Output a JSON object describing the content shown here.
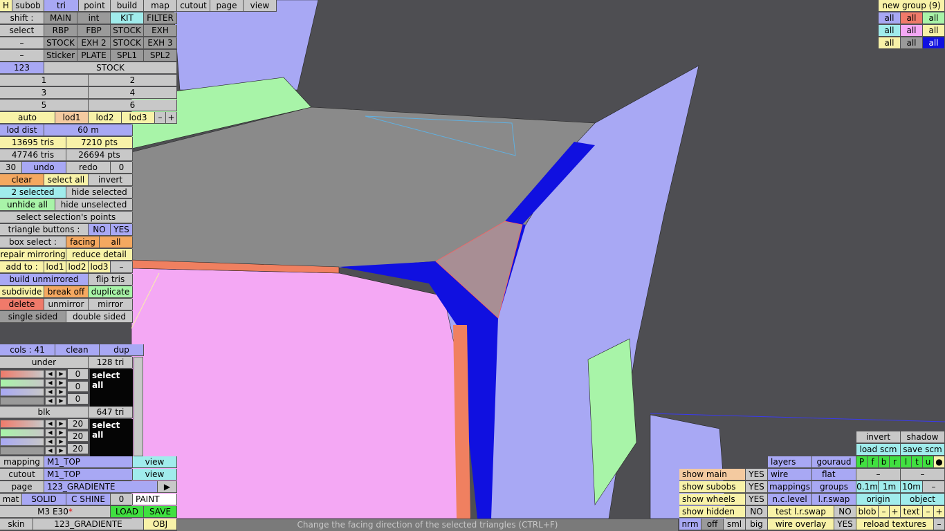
{
  "topbar": {
    "h": "H",
    "subob": "subob",
    "tri": "tri",
    "point": "point",
    "build": "build",
    "map": "map",
    "cutout": "cutout",
    "page": "page",
    "view": "view"
  },
  "shift_row": {
    "label": "shift :",
    "items": [
      "MAIN",
      "int",
      "KIT",
      "FILTER"
    ]
  },
  "select_row": {
    "label": "select",
    "items": [
      "RBP",
      "FBP",
      "STOCK",
      "EXH"
    ]
  },
  "row4": {
    "label": "–",
    "items": [
      "STOCK",
      "EXH 2",
      "STOCK",
      "EXH 3"
    ]
  },
  "row5": {
    "label": "–",
    "items": [
      "Sticker",
      "PLATE",
      "SPL1",
      "SPL2"
    ]
  },
  "group_row": {
    "num": "123",
    "name": "STOCK"
  },
  "numbers": [
    "1",
    "2",
    "3",
    "4",
    "5",
    "6"
  ],
  "lod": {
    "auto": "auto",
    "lod1": "lod1",
    "lod2": "lod2",
    "lod3": "lod3",
    "minus": "–",
    "plus": "+"
  },
  "lod_dist": {
    "label": "lod dist",
    "value": "60 m"
  },
  "stats": {
    "tris1": "13695 tris",
    "pts1": "7210 pts",
    "tris2": "47746 tris",
    "pts2": "26694 pts"
  },
  "undo_row": {
    "left": "30",
    "undo": "undo",
    "redo": "redo",
    "right": "0"
  },
  "selection": {
    "clear": "clear",
    "select_all": "select all",
    "invert": "invert",
    "count": "2 selected",
    "hide_selected": "hide selected",
    "unhide_all": "unhide all",
    "hide_unselected": "hide unselected",
    "select_points": "select selection's points"
  },
  "triangle_buttons": {
    "label": "triangle buttons :",
    "no": "NO",
    "yes": "YES"
  },
  "box_select": {
    "label": "box select :",
    "facing": "facing",
    "all": "all"
  },
  "repair": {
    "repair": "repair mirroring",
    "reduce": "reduce detail"
  },
  "add_to": {
    "label": "add to :",
    "lod1": "lod1",
    "lod2": "lod2",
    "lod3": "lod3",
    "dash": "–"
  },
  "build_row": {
    "build": "build unmirrored",
    "flip": "flip tris"
  },
  "subdivide_row": {
    "subdivide": "subdivide",
    "break": "break off",
    "duplicate": "duplicate"
  },
  "delete_row": {
    "delete": "delete",
    "unmirror": "unmirror",
    "mirror": "mirror"
  },
  "sided_row": {
    "single": "single sided",
    "double": "double sided"
  },
  "cols": {
    "label": "cols : 41",
    "clean": "clean",
    "dup": "dup"
  },
  "under": {
    "name": "under",
    "tris": "128 tri",
    "values": [
      "0",
      "0",
      "0"
    ],
    "select_all": "select all"
  },
  "blk": {
    "name": "blk",
    "tris": "647 tri",
    "values": [
      "20",
      "20",
      "20"
    ],
    "select_all": "select all"
  },
  "mapping": {
    "label": "mapping",
    "value": "M1_TOP",
    "view": "view"
  },
  "cutout": {
    "label": "cutout",
    "value": "M1_TOP",
    "view": "view"
  },
  "page_row": {
    "label": "page",
    "value": "123_GRADIENTE",
    "arrow": "▶"
  },
  "mat_row": {
    "mat": "mat",
    "solid": "SOLID",
    "shine": "C SHINE",
    "zero": "0",
    "paint": "PAINT"
  },
  "model_row": {
    "name": "M3 E30",
    "star": "*",
    "load": "LOAD",
    "save": "SAVE"
  },
  "skin_row": {
    "skin": "skin",
    "value": "123_GRADIENTE",
    "obj": "OBJ"
  },
  "status": "Change the facing direction of the selected triangles (CTRL+F)",
  "new_group": {
    "label": "new group (9)",
    "all": "all"
  },
  "bottom_right": {
    "show_main": "show main",
    "show_subobs": "show subobs",
    "show_wheels": "show wheels",
    "show_hidden": "show hidden",
    "yes": "YES",
    "no": "NO",
    "nrm": "nrm",
    "off": "off",
    "sml": "sml",
    "big": "big",
    "layers": "layers",
    "gouraud": "gouraud",
    "wire": "wire",
    "flat": "flat",
    "mappings": "mappings",
    "groups": "groups",
    "nc_level": "n.c.level",
    "lr_swap": "l.r.swap",
    "test_lr_swap": "test l.r.swap",
    "wire_overlay": "wire overlay",
    "invert": "invert",
    "shadow": "shadow",
    "load_scm": "load scm",
    "save_scm": "save scm",
    "letters": [
      "P",
      "f",
      "b",
      "r",
      "l",
      "t",
      "u",
      "●"
    ],
    "dash": "–",
    "d01": "0.1m",
    "d1": "1m",
    "d10": "10m",
    "origin": "origin",
    "object": "object",
    "blob": "blob",
    "text": "text",
    "minus": "–",
    "plus": "+",
    "reload": "reload textures"
  },
  "colors": {
    "background": "#4e4e52",
    "mesh_blue": "#a8a8f4",
    "mesh_gray": "#8a8a8a",
    "mesh_pink": "#f4a8f4",
    "selected": "#1010e0",
    "accent_red": "#f08060"
  }
}
